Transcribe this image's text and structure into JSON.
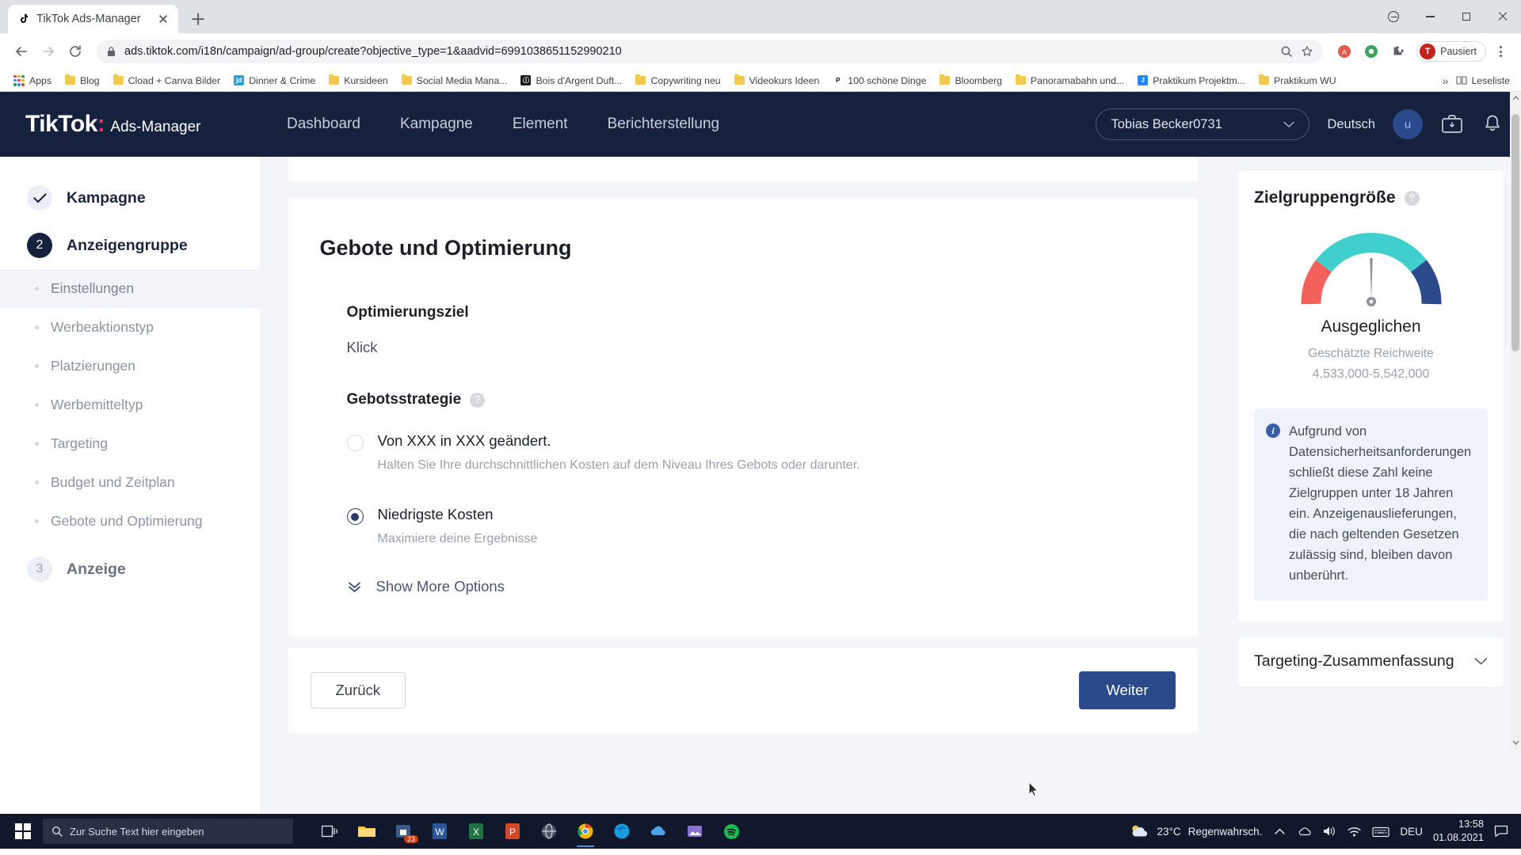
{
  "browser": {
    "tab": {
      "title": "TikTok Ads-Manager",
      "favicon": "tiktok-note-icon",
      "close": "close-icon"
    },
    "new_tab": "+",
    "window_controls": {
      "minimize": "minimize-icon",
      "maximize": "maximize-icon",
      "close": "close-icon",
      "restore": "restore-icon"
    },
    "url": "ads.tiktok.com/i18n/campaign/ad-group/create?objective_type=1&aadvid=6991038651152990210",
    "profile_chip": {
      "initial": "T",
      "label": "Pausiert"
    },
    "bookmarks": [
      {
        "label": "Apps",
        "icon": "apps-grid-icon",
        "type": "apps"
      },
      {
        "label": "Blog",
        "icon": "folder-icon",
        "type": "folder"
      },
      {
        "label": "Cload + Canva Bilder",
        "icon": "folder-icon",
        "type": "folder"
      },
      {
        "label": "Dinner & Crime",
        "icon": "jd-icon",
        "type": "site",
        "color": "#2e9fd6",
        "glyph": "jd"
      },
      {
        "label": "Kursideen",
        "icon": "folder-icon",
        "type": "folder"
      },
      {
        "label": "Social Media Mana...",
        "icon": "folder-icon",
        "type": "folder"
      },
      {
        "label": "Bois d'Argent Duft...",
        "icon": "bois-icon",
        "type": "site",
        "color": "#1a1a1a",
        "glyph": "Ⓘ"
      },
      {
        "label": "Copywriting neu",
        "icon": "folder-icon",
        "type": "folder"
      },
      {
        "label": "Videokurs Ideen",
        "icon": "folder-icon",
        "type": "folder"
      },
      {
        "label": "100 schöne Dinge",
        "icon": "pinterest-icon",
        "type": "site",
        "color": "#ffffff",
        "glyph": "P"
      },
      {
        "label": "Bloomberg",
        "icon": "folder-icon",
        "type": "folder"
      },
      {
        "label": "Panoramabahn und...",
        "icon": "folder-icon",
        "type": "folder"
      },
      {
        "label": "Praktikum Projektm...",
        "icon": "jira-icon",
        "type": "site",
        "color": "#2684ff",
        "glyph": "J"
      },
      {
        "label": "Praktikum WU",
        "icon": "folder-icon",
        "type": "folder"
      }
    ],
    "overflow": "»",
    "reading_list": "Leseliste"
  },
  "tiktok": {
    "logo": {
      "brand": "TikTok",
      "product": "Ads-Manager"
    },
    "nav": [
      {
        "label": "Dashboard"
      },
      {
        "label": "Kampagne"
      },
      {
        "label": "Element"
      },
      {
        "label": "Berichterstellung"
      }
    ],
    "account": {
      "name": "Tobias Becker0731",
      "chevron": "chevron-down-icon"
    },
    "language": "Deutsch",
    "avatar_initial": "u",
    "icons": {
      "inbox": "inbox-briefcase-icon",
      "bell": "bell-icon"
    }
  },
  "sidebar": {
    "steps": [
      {
        "badge": "✓",
        "label": "Kampagne",
        "state": "done"
      },
      {
        "badge": "2",
        "label": "Anzeigengruppe",
        "state": "active"
      }
    ],
    "sub_items": [
      {
        "label": "Einstellungen",
        "active": true
      },
      {
        "label": "Werbeaktionstyp",
        "active": false
      },
      {
        "label": "Platzierungen",
        "active": false
      },
      {
        "label": "Werbemitteltyp",
        "active": false
      },
      {
        "label": "Targeting",
        "active": false
      },
      {
        "label": "Budget und Zeitplan",
        "active": false
      },
      {
        "label": "Gebote und Optimierung",
        "active": false
      }
    ],
    "final_step": {
      "badge": "3",
      "label": "Anzeige",
      "state": "idle"
    }
  },
  "main": {
    "card_title": "Gebote und Optimierung",
    "optimization": {
      "label": "Optimierungsziel",
      "value": "Klick"
    },
    "bid_strategy": {
      "label": "Gebotsstrategie",
      "help": "?",
      "options": [
        {
          "label": "Von XXX in XXX geändert.",
          "description": "Halten Sie Ihre durchschnittlichen Kosten auf dem Niveau Ihres Gebots oder darunter.",
          "selected": false
        },
        {
          "label": "Niedrigste Kosten",
          "description": "Maximiere deine Ergebnisse",
          "selected": true
        }
      ]
    },
    "show_more": {
      "label": "Show More Options",
      "icon": "double-chevron-down-icon"
    },
    "footer": {
      "back": "Zurück",
      "next": "Weiter"
    }
  },
  "rail": {
    "audience": {
      "title": "Zielgruppengröße",
      "help": "?",
      "status": "Ausgeglichen",
      "reach_label": "Geschätzte Reichweite",
      "reach_value": "4,533,000-5,542,000",
      "gauge_colors": {
        "low": "#f4605a",
        "mid": "#3fd0cd",
        "high": "#2b4a8b",
        "needle": "#8a8f99"
      }
    },
    "info_note": "Aufgrund von Datensicherheitsanforderungen schließt diese Zahl keine Zielgruppen unter 18 Jahren ein. Anzeigenauslieferungen, die nach geltenden Gesetzen zulässig sind, bleiben davon unberührt.",
    "targeting_summary": {
      "title": "Targeting-Zusammenfassung",
      "chevron": "chevron-down-icon"
    }
  },
  "taskbar": {
    "start": "windows-start-icon",
    "search_placeholder": "Zur Suche Text hier eingeben",
    "apps": [
      {
        "name": "task-view-icon"
      },
      {
        "name": "file-explorer-icon"
      },
      {
        "name": "store-icon",
        "badge": "23"
      },
      {
        "name": "word-icon"
      },
      {
        "name": "excel-icon"
      },
      {
        "name": "powerpoint-icon"
      },
      {
        "name": "browser-globe-icon"
      },
      {
        "name": "chrome-icon",
        "active": true
      },
      {
        "name": "edge-icon"
      },
      {
        "name": "onedrive-icon"
      },
      {
        "name": "photos-icon"
      },
      {
        "name": "spotify-icon"
      }
    ],
    "weather": {
      "temp": "23°C",
      "desc": "Regenwahrsch.",
      "icon": "partly-cloudy-icon"
    },
    "tray": [
      "chevron-up-icon",
      "onedrive-icon",
      "volume-icon",
      "wifi-icon",
      "keyboard-icon"
    ],
    "language": "DEU",
    "time": "13:58",
    "date": "01.08.2021",
    "action_center": "notification-icon"
  }
}
